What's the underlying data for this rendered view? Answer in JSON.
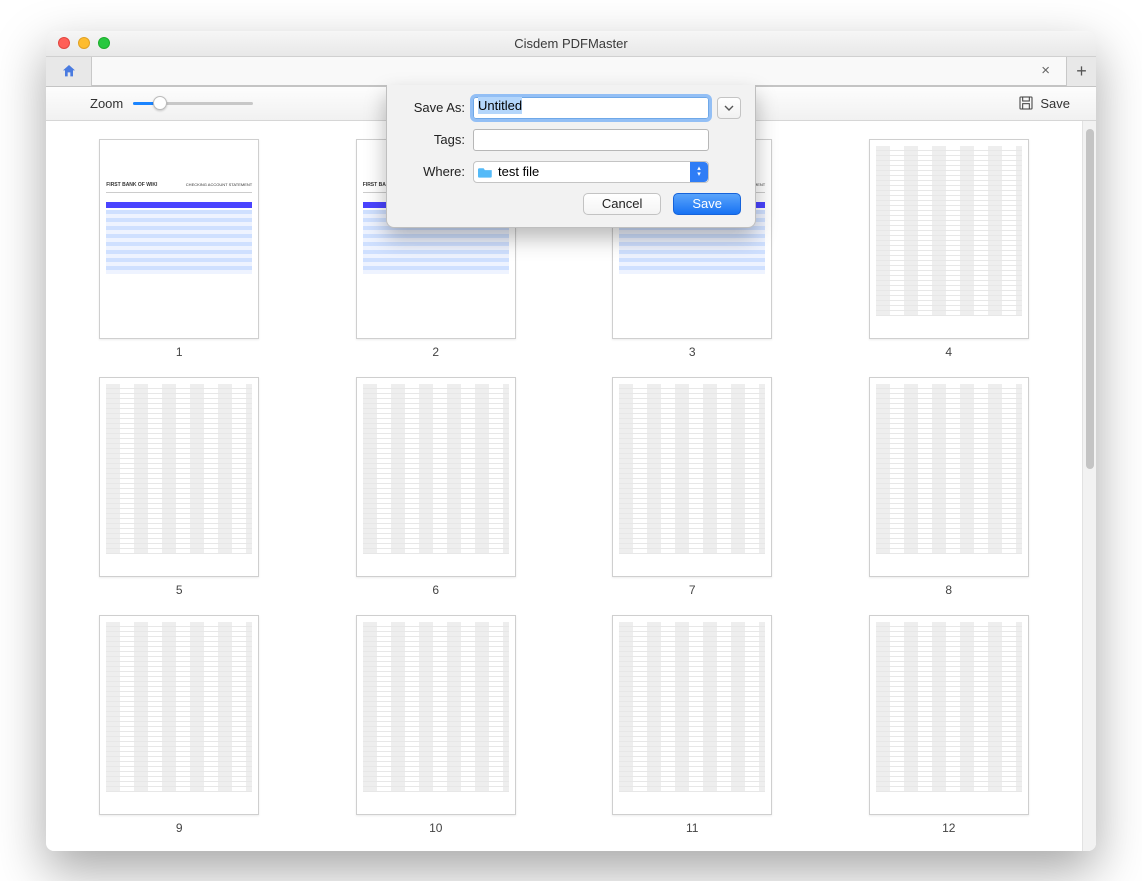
{
  "window": {
    "title": "Cisdem PDFMaster"
  },
  "tabbar": {
    "close_label": "×",
    "plus_label": "+"
  },
  "toolbar": {
    "zoom_label": "Zoom",
    "save_label": "Save"
  },
  "dialog": {
    "saveas_label": "Save As:",
    "saveas_value": "Untitled",
    "tags_label": "Tags:",
    "tags_value": "",
    "where_label": "Where:",
    "where_value": "test file",
    "cancel_label": "Cancel",
    "save_label": "Save"
  },
  "pages": [
    {
      "num": "1",
      "style": "A"
    },
    {
      "num": "2",
      "style": "A"
    },
    {
      "num": "3",
      "style": "A"
    },
    {
      "num": "4",
      "style": "B"
    },
    {
      "num": "5",
      "style": "B"
    },
    {
      "num": "6",
      "style": "B"
    },
    {
      "num": "7",
      "style": "B"
    },
    {
      "num": "8",
      "style": "B"
    },
    {
      "num": "9",
      "style": "B"
    },
    {
      "num": "10",
      "style": "B"
    },
    {
      "num": "11",
      "style": "B"
    },
    {
      "num": "12",
      "style": "B"
    }
  ],
  "doc_sample": {
    "bank_title": "FIRST BANK OF WIKI",
    "stmt_label": "CHECKING ACCOUNT STATEMENT"
  }
}
